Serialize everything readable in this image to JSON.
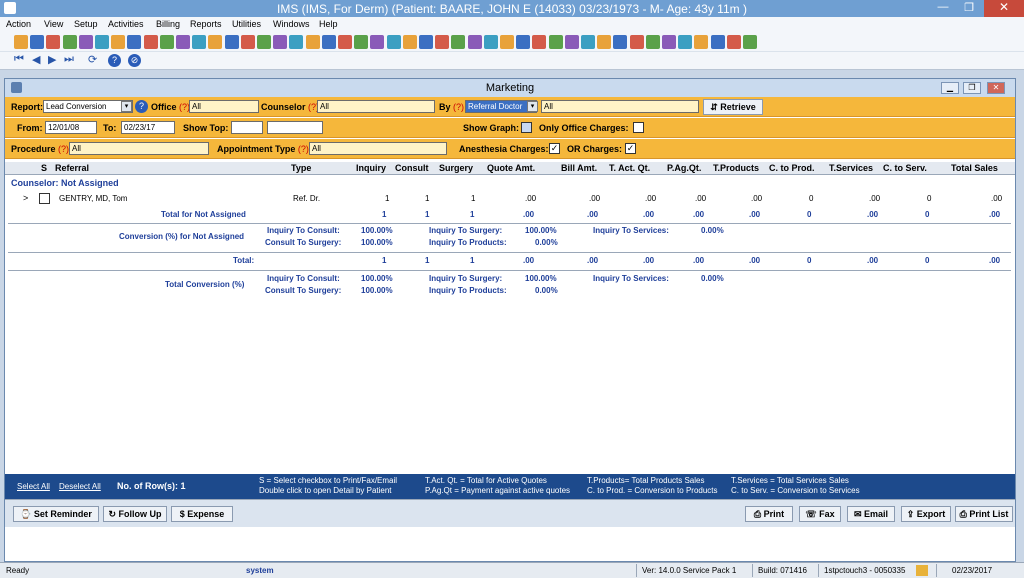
{
  "window": {
    "title": "IMS (IMS, For Derm)     (Patient: BAARE, JOHN E (14033) 03/23/1973 - M- Age: 43y 11m )"
  },
  "menu": [
    "Action",
    "View",
    "Setup",
    "Activities",
    "Billing",
    "Reports",
    "Utilities",
    "Windows",
    "Help"
  ],
  "child": {
    "title": "Marketing"
  },
  "filters": {
    "report_label": "Report:",
    "report_value": "Lead Conversion",
    "office_label": "Office",
    "office_q": "(?)",
    "office_value": "All",
    "counselor_label": "Counselor",
    "counselor_q": "(?)",
    "counselor_value": "All",
    "by_label": "By",
    "by_q": "(?)",
    "by_value": "Referral Doctor",
    "by_filter": "All",
    "retrieve": "Retrieve",
    "from_label": "From:",
    "from_value": "12/01/08",
    "to_label": "To:",
    "to_value": "02/23/17",
    "showtop_label": "Show Top:",
    "showgraph_label": "Show Graph:",
    "office_charges_label": "Only Office Charges:",
    "procedure_label": "Procedure",
    "procedure_q": "(?)",
    "procedure_value": "All",
    "appt_label": "Appointment Type",
    "appt_q": "(?)",
    "appt_value": "All",
    "anesthesia_label": "Anesthesia Charges:",
    "or_label": "OR Charges:"
  },
  "columns": [
    "S",
    "Referral",
    "Type",
    "Inquiry",
    "Consult",
    "Surgery",
    "Quote Amt.",
    "Bill Amt.",
    "T. Act. Qt.",
    "P.Ag.Qt.",
    "T.Products",
    "C. to Prod.",
    "T.Services",
    "C. to Serv.",
    "Total Sales"
  ],
  "group_label": "Counselor: Not Assigned",
  "row": {
    "expander": ">",
    "referral": "GENTRY, MD, Tom",
    "type": "Ref. Dr.",
    "inquiry": "1",
    "consult": "1",
    "surgery": "1",
    "quote": ".00",
    "bill": ".00",
    "tact": ".00",
    "pag": ".00",
    "tprod": ".00",
    "cprod": "0",
    "tserv": ".00",
    "cserv": "0",
    "total": ".00"
  },
  "subtotal": {
    "label": "Total for Not Assigned",
    "inquiry": "1",
    "consult": "1",
    "surgery": "1",
    "quote": ".00",
    "bill": ".00",
    "tact": ".00",
    "pag": ".00",
    "tprod": ".00",
    "cprod": "0",
    "tserv": ".00",
    "cserv": "0",
    "total": ".00"
  },
  "conv1": {
    "label": "Conversion (%) for Not Assigned",
    "itc_l": "Inquiry To Consult:",
    "itc": "100.00%",
    "cts_l": "Consult To Surgery:",
    "cts": "100.00%",
    "its_l": "Inquiry To Surgery:",
    "its": "100.00%",
    "itp_l": "Inquiry To Products:",
    "itp": "0.00%",
    "itsv_l": "Inquiry To Services:",
    "itsv": "0.00%"
  },
  "total": {
    "label": "Total:",
    "inquiry": "1",
    "consult": "1",
    "surgery": "1",
    "quote": ".00",
    "bill": ".00",
    "tact": ".00",
    "pag": ".00",
    "tprod": ".00",
    "cprod": "0",
    "tserv": ".00",
    "cserv": "0",
    "total": ".00"
  },
  "conv2": {
    "label": "Total Conversion (%)",
    "itc_l": "Inquiry To Consult:",
    "itc": "100.00%",
    "cts_l": "Consult To Surgery:",
    "cts": "100.00%",
    "its_l": "Inquiry To Surgery:",
    "its": "100.00%",
    "itp_l": "Inquiry To Products:",
    "itp": "0.00%",
    "itsv_l": "Inquiry To Services:",
    "itsv": "0.00%"
  },
  "legend": {
    "select_all": "Select All",
    "deselect_all": "Deselect All",
    "rows": "No. of Row(s): 1",
    "l1": "S = Select checkbox to Print/Fax/Email",
    "l2": "Double click to open Detail by Patient",
    "l3": "T.Act. Qt. = Total for Active Quotes",
    "l4": "P.Ag.Qt = Payment against active quotes",
    "l5": "T.Products= Total Products Sales",
    "l6": "C. to Prod. = Conversion to Products",
    "l7": "T.Services = Total Services Sales",
    "l8": "C. to Serv. = Conversion to Services"
  },
  "actions": {
    "set_reminder": "Set Reminder",
    "follow_up": "Follow Up",
    "expense": "Expense",
    "print": "Print",
    "fax": "Fax",
    "email": "Email",
    "export": "Export",
    "print_list": "Print List"
  },
  "status": {
    "ready": "Ready",
    "user": "system",
    "version": "Ver: 14.0.0 Service Pack 1",
    "build": "Build: 071416",
    "station": "1stpctouch3 - 0050335",
    "date": "02/23/2017"
  },
  "colors": {
    "accent_orange": "#f5b73b",
    "legend_blue": "#1d4a8c",
    "titlebar": "#6f9fd2"
  }
}
